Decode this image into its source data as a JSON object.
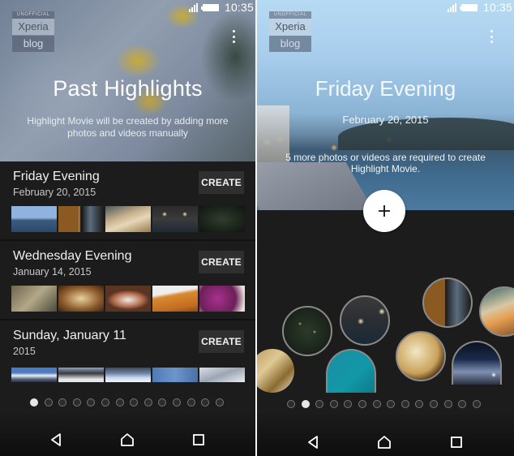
{
  "status_bar": {
    "time": "10:35",
    "signal_icon": "signal-icon",
    "battery_icon": "battery-icon"
  },
  "watermark": {
    "line1": "UNOFFICIAL",
    "line2": "Xperia",
    "line3": "blog"
  },
  "left_screen": {
    "header": {
      "title": "Past Highlights",
      "subtitle": "Highlight Movie will be created by adding more photos and videos manually"
    },
    "events": [
      {
        "name": "Friday Evening",
        "date": "February 20, 2015",
        "create_label": "CREATE",
        "thumbnails": [
          "harbor-evening",
          "curtain-window",
          "buffet-table",
          "restaurant-lights",
          "christmas-tree"
        ]
      },
      {
        "name": "Wednesday Evening",
        "date": "January 14, 2015",
        "create_label": "CREATE",
        "thumbnails": [
          "street-alley",
          "roast-dish",
          "plate-dinner",
          "noodle-dish",
          "purple-flowers"
        ]
      },
      {
        "name": "Sunday, January 11",
        "date": "2015",
        "create_label": "CREATE",
        "thumbnails": [
          "snowy-mountain",
          "snowy-street",
          "snowy-forest",
          "frosted-window",
          "snowy-hill"
        ]
      }
    ],
    "pager": {
      "count": 14,
      "active_index": 0
    }
  },
  "right_screen": {
    "header": {
      "title": "Friday Evening",
      "date": "February 20, 2015",
      "message": "5 more photos or videos are required to create Highlight Movie."
    },
    "fab_icon": "plus-icon",
    "bubbles": [
      "pastry-rolls",
      "christmas-tree",
      "restaurant-lights",
      "billiards-table",
      "noodle-dish",
      "curtain-window",
      "night-city",
      "buffet-table"
    ],
    "pager": {
      "count": 14,
      "active_index": 1
    }
  },
  "nav": {
    "back": "back-icon",
    "home": "home-icon",
    "recents": "recents-icon"
  }
}
